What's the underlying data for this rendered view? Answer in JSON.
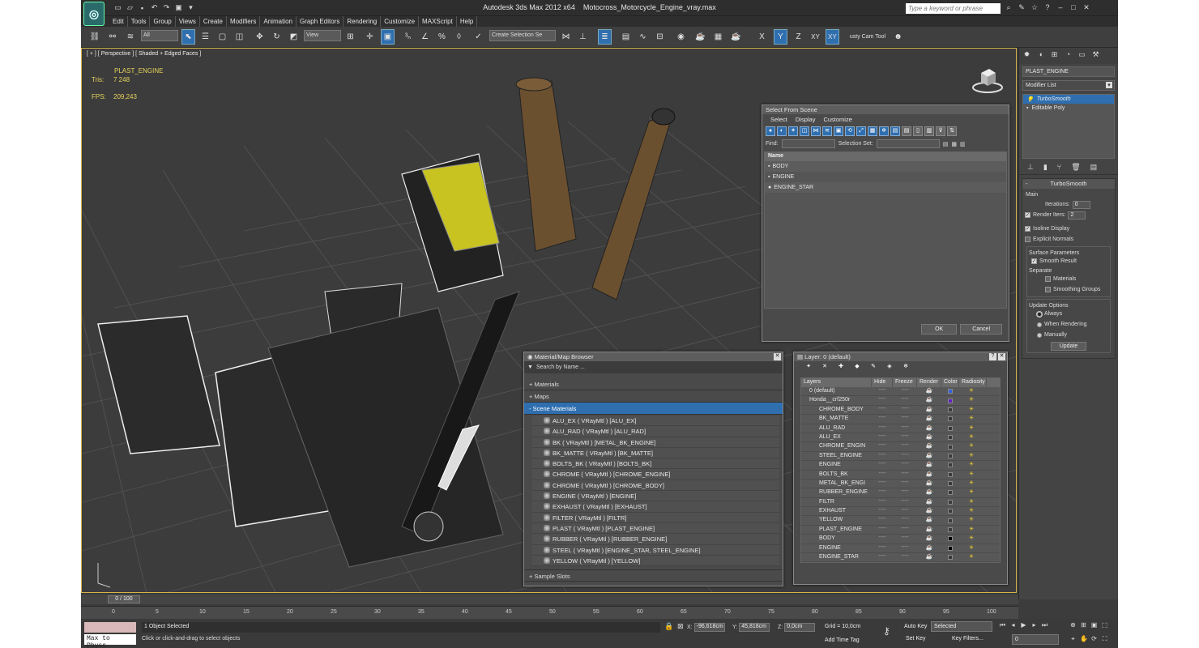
{
  "app": {
    "title": "Autodesk 3ds Max  2012 x64",
    "filename": "Motocross_Motorcycle_Engine_vray.max",
    "search_placeholder": "Type a keyword or phrase",
    "logo": "max-logo"
  },
  "menu": [
    "Edit",
    "Tools",
    "Group",
    "Views",
    "Create",
    "Modifiers",
    "Animation",
    "Graph Editors",
    "Rendering",
    "Customize",
    "MAXScript",
    "Help"
  ],
  "toolbar": {
    "filter": "All",
    "refcoord": "View",
    "selset": "Create Selection Se",
    "axes": [
      "X",
      "Y",
      "Z",
      "XY",
      "XY"
    ],
    "cam_tool": "usty Cam Tool"
  },
  "viewport": {
    "label": "[ + ] [ Perspective ] [ Shaded + Edged Faces ]",
    "object": "PLAST_ENGINE",
    "tris_label": "Tris:",
    "tris": "7 248",
    "fps_label": "FPS:",
    "fps": "209,243"
  },
  "select_dlg": {
    "title": "Select From Scene",
    "menu": [
      "Select",
      "Display",
      "Customize"
    ],
    "find_label": "Find:",
    "selset_label": "Selection Set:",
    "col_name": "Name",
    "items": [
      "BODY",
      "ENGINE",
      "ENGINE_STAR"
    ],
    "ok": "OK",
    "cancel": "Cancel"
  },
  "mat_browser": {
    "title": "Material/Map Browser",
    "search": "Search by Name ...",
    "sections": [
      "+ Materials",
      "+ Maps",
      "- Scene Materials"
    ],
    "materials": [
      "ALU_EX  ( VRayMtl ) [ALU_EX]",
      "ALU_RAD  ( VRayMtl ) [ALU_RAD]",
      "BK  ( VRayMtl ) [METAL_BK_ENGINE]",
      "BK_MATTE  ( VRayMtl ) [BK_MATTE]",
      "BOLTS_BK  ( VRayMtl ) [BOLTS_BK]",
      "CHROME  ( VRayMtl ) [CHROME_ENGINE]",
      "CHROME  ( VRayMtl ) [CHROME_BODY]",
      "ENGINE  ( VRayMtl ) [ENGINE]",
      "EXHAUST  ( VRayMtl ) [EXHAUST]",
      "FILTER  ( VRayMtl ) [FILTR]",
      "PLAST  ( VRayMtl ) [PLAST_ENGINE]",
      "RUBBER  ( VRayMtl ) [RUBBER_ENGINE]",
      "STEEL  ( VRayMtl ) [ENGINE_STAR, STEEL_ENGINE]",
      "YELLOW  ( VRayMtl ) [YELLOW]"
    ],
    "sample_slots": "+ Sample Slots"
  },
  "layer_dlg": {
    "title": "Layer: 0 (default)",
    "cols": [
      "Layers",
      "Hide",
      "Freeze",
      "Render",
      "Color",
      "Radiosity"
    ],
    "rows": [
      {
        "name": "0 (default)",
        "color": "#3060e0",
        "indent": 0
      },
      {
        "name": "Honda__crf250r",
        "color": "#6020c0",
        "indent": 0
      },
      {
        "name": "CHROME_BODY",
        "color": "#3a3a3a",
        "indent": 1
      },
      {
        "name": "BK_MATTE",
        "color": "#3a3a3a",
        "indent": 1
      },
      {
        "name": "ALU_RAD",
        "color": "#3a3a3a",
        "indent": 1
      },
      {
        "name": "ALU_EX",
        "color": "#3a3a3a",
        "indent": 1
      },
      {
        "name": "CHROME_ENGIN",
        "color": "#3a3a3a",
        "indent": 1
      },
      {
        "name": "STEEL_ENGINE",
        "color": "#3a3a3a",
        "indent": 1
      },
      {
        "name": "ENGINE",
        "color": "#3a3a3a",
        "indent": 1
      },
      {
        "name": "BOLTS_BK",
        "color": "#3a3a3a",
        "indent": 1
      },
      {
        "name": "METAL_BK_ENGI",
        "color": "#3a3a3a",
        "indent": 1
      },
      {
        "name": "RUBBER_ENGINE",
        "color": "#3a3a3a",
        "indent": 1
      },
      {
        "name": "FILTR",
        "color": "#3a3a3a",
        "indent": 1
      },
      {
        "name": "EXHAUST",
        "color": "#3a3a3a",
        "indent": 1
      },
      {
        "name": "YELLOW",
        "color": "#3a3a3a",
        "indent": 1
      },
      {
        "name": "PLAST_ENGINE",
        "color": "#3a3a3a",
        "indent": 1
      },
      {
        "name": "BODY",
        "color": "#000000",
        "indent": 1
      },
      {
        "name": "ENGINE",
        "color": "#000000",
        "indent": 1
      },
      {
        "name": "ENGINE_STAR",
        "color": "#3a3a3a",
        "indent": 1
      }
    ]
  },
  "command_panel": {
    "object_name": "PLAST_ENGINE",
    "modifier_list": "Modifier List",
    "stack": [
      "TurboSmooth",
      "Editable Poly"
    ],
    "rollout": "TurboSmooth",
    "main": "Main",
    "iterations_label": "Iterations:",
    "iterations": "0",
    "render_iters_label": "Render Iters:",
    "render_iters": "2",
    "isoline": "Isoline Display",
    "explicit": "Explicit Normals",
    "surface": "Surface Parameters",
    "smooth": "Smooth Result",
    "separate": "Separate",
    "materials": "Materials",
    "smoothing": "Smoothing Groups",
    "update_opts": "Update Options",
    "always": "Always",
    "when_rendering": "When Rendering",
    "manually": "Manually",
    "update": "Update"
  },
  "timeline": {
    "frame": "0 / 100",
    "ticks": [
      "0",
      "5",
      "10",
      "15",
      "20",
      "25",
      "30",
      "35",
      "40",
      "45",
      "50",
      "55",
      "60",
      "65",
      "70",
      "75",
      "80",
      "85",
      "90",
      "95",
      "100"
    ]
  },
  "status": {
    "maxscript": "Max to Physc.",
    "selected": "1 Object Selected",
    "hint": "Click or click-and-drag to select objects",
    "x_label": "X:",
    "x": "-96,618cm",
    "y_label": "Y:",
    "y": "45,818cm",
    "z_label": "Z:",
    "z": "0,0cm",
    "grid": "Grid = 10,0cm",
    "add_time_tag": "Add Time Tag",
    "auto_key": "Auto Key",
    "set_key": "Set Key",
    "key_mode": "Selected",
    "key_filters": "Key Filters...",
    "frame_field": "0"
  }
}
